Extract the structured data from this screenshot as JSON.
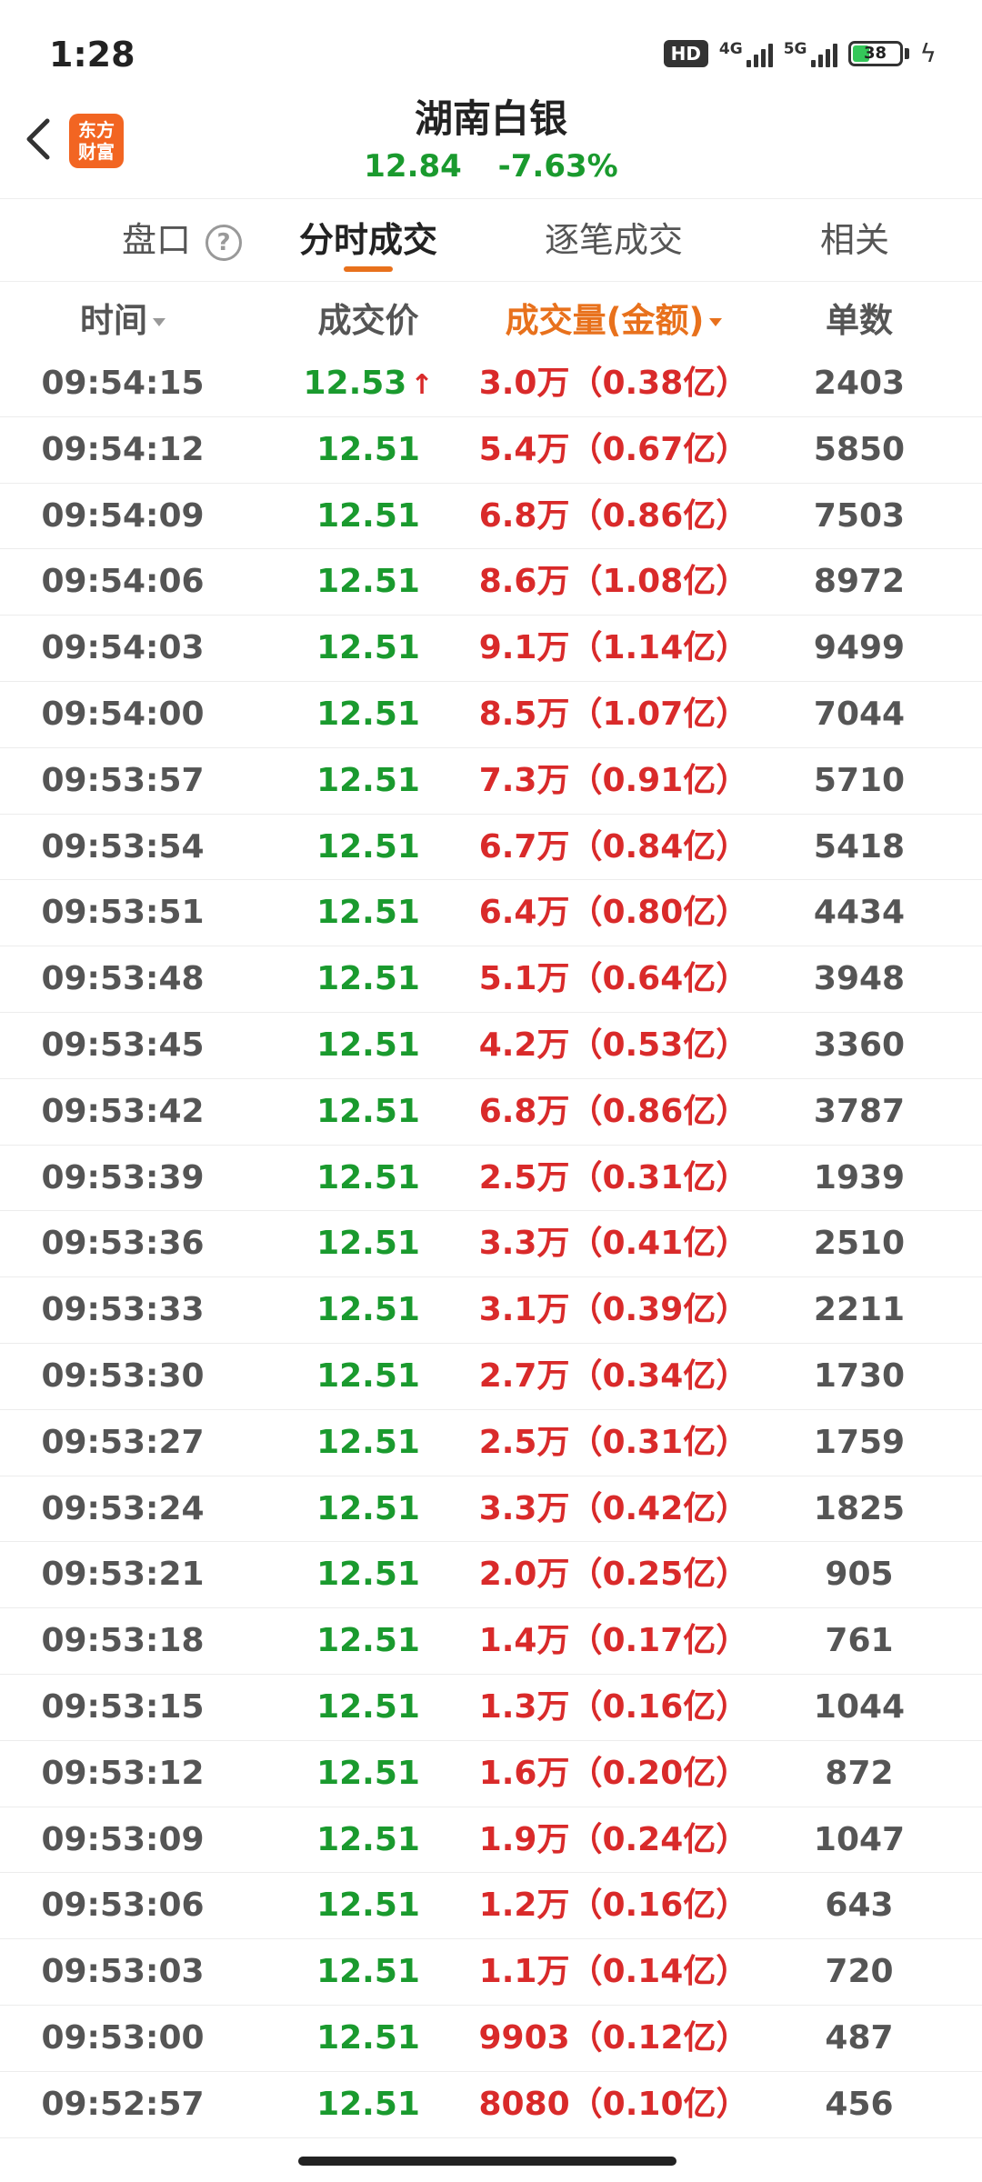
{
  "status_bar": {
    "time": "1:28",
    "hd_badge": "HD",
    "network_1": "4G",
    "network_2": "5G",
    "battery": "38",
    "icons": [
      "hd-icon",
      "signal-4g-icon",
      "signal-5g-icon",
      "battery-icon",
      "charging-bolt-icon"
    ]
  },
  "header": {
    "app_logo_text_line1": "东方",
    "app_logo_text_line2": "财富",
    "stock_name": "湖南白银",
    "price": "12.84",
    "change_pct": "-7.63%",
    "quote_color": "#1a9a2e"
  },
  "tabs": [
    {
      "label": "盘口",
      "active": false
    },
    {
      "label": "分时成交",
      "active": true
    },
    {
      "label": "逐笔成交",
      "active": false
    },
    {
      "label": "相关",
      "active": false
    }
  ],
  "columns": {
    "time": "时间",
    "price": "成交价",
    "volume": "成交量(金额)",
    "count": "单数",
    "sort_color": "#e8711c"
  },
  "rows": [
    {
      "time": "09:54:15",
      "price": "12.53",
      "up": true,
      "volume": "3.0万（0.38亿）",
      "count": "2403"
    },
    {
      "time": "09:54:12",
      "price": "12.51",
      "volume": "5.4万（0.67亿）",
      "count": "5850"
    },
    {
      "time": "09:54:09",
      "price": "12.51",
      "volume": "6.8万（0.86亿）",
      "count": "7503"
    },
    {
      "time": "09:54:06",
      "price": "12.51",
      "volume": "8.6万（1.08亿）",
      "count": "8972"
    },
    {
      "time": "09:54:03",
      "price": "12.51",
      "volume": "9.1万（1.14亿）",
      "count": "9499"
    },
    {
      "time": "09:54:00",
      "price": "12.51",
      "volume": "8.5万（1.07亿）",
      "count": "7044"
    },
    {
      "time": "09:53:57",
      "price": "12.51",
      "volume": "7.3万（0.91亿）",
      "count": "5710"
    },
    {
      "time": "09:53:54",
      "price": "12.51",
      "volume": "6.7万（0.84亿）",
      "count": "5418"
    },
    {
      "time": "09:53:51",
      "price": "12.51",
      "volume": "6.4万（0.80亿）",
      "count": "4434"
    },
    {
      "time": "09:53:48",
      "price": "12.51",
      "volume": "5.1万（0.64亿）",
      "count": "3948"
    },
    {
      "time": "09:53:45",
      "price": "12.51",
      "volume": "4.2万（0.53亿）",
      "count": "3360"
    },
    {
      "time": "09:53:42",
      "price": "12.51",
      "volume": "6.8万（0.86亿）",
      "count": "3787"
    },
    {
      "time": "09:53:39",
      "price": "12.51",
      "volume": "2.5万（0.31亿）",
      "count": "1939"
    },
    {
      "time": "09:53:36",
      "price": "12.51",
      "volume": "3.3万（0.41亿）",
      "count": "2510"
    },
    {
      "time": "09:53:33",
      "price": "12.51",
      "volume": "3.1万（0.39亿）",
      "count": "2211"
    },
    {
      "time": "09:53:30",
      "price": "12.51",
      "volume": "2.7万（0.34亿）",
      "count": "1730"
    },
    {
      "time": "09:53:27",
      "price": "12.51",
      "volume": "2.5万（0.31亿）",
      "count": "1759"
    },
    {
      "time": "09:53:24",
      "price": "12.51",
      "volume": "3.3万（0.42亿）",
      "count": "1825"
    },
    {
      "time": "09:53:21",
      "price": "12.51",
      "volume": "2.0万（0.25亿）",
      "count": "905"
    },
    {
      "time": "09:53:18",
      "price": "12.51",
      "volume": "1.4万（0.17亿）",
      "count": "761"
    },
    {
      "time": "09:53:15",
      "price": "12.51",
      "volume": "1.3万（0.16亿）",
      "count": "1044"
    },
    {
      "time": "09:53:12",
      "price": "12.51",
      "volume": "1.6万（0.20亿）",
      "count": "872"
    },
    {
      "time": "09:53:09",
      "price": "12.51",
      "volume": "1.9万（0.24亿）",
      "count": "1047"
    },
    {
      "time": "09:53:06",
      "price": "12.51",
      "volume": "1.2万（0.16亿）",
      "count": "643"
    },
    {
      "time": "09:53:03",
      "price": "12.51",
      "volume": "1.1万（0.14亿）",
      "count": "720"
    },
    {
      "time": "09:53:00",
      "price": "12.51",
      "volume": "9903（0.12亿）",
      "count": "487"
    },
    {
      "time": "09:52:57",
      "price": "12.51",
      "volume": "8080（0.10亿）",
      "count": "456"
    }
  ],
  "colors": {
    "price_green": "#1a9a2e",
    "volume_red": "#d92a2a",
    "accent_orange": "#e8711c"
  }
}
